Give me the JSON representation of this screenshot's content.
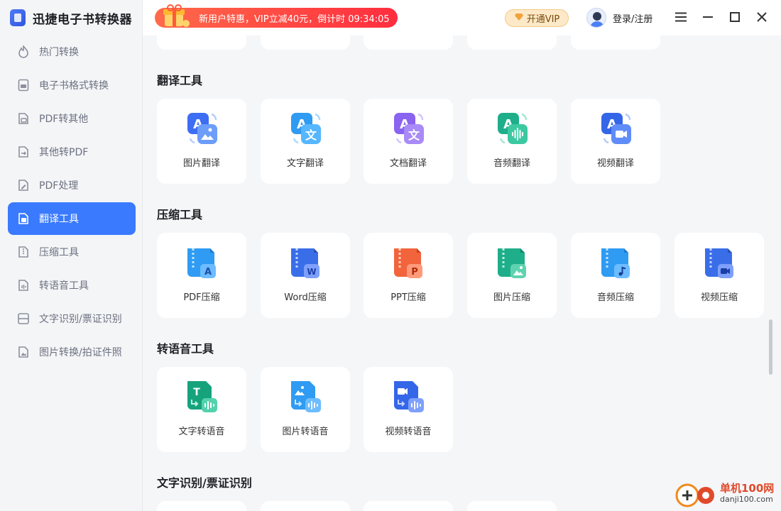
{
  "app": {
    "title": "迅捷电子书转换器"
  },
  "sidebar": {
    "items": [
      {
        "label": "热门转换",
        "icon": "flame-icon"
      },
      {
        "label": "电子书格式转换",
        "icon": "ebook-icon"
      },
      {
        "label": "PDF转其他",
        "icon": "pdf-export-icon"
      },
      {
        "label": "其他转PDF",
        "icon": "pdf-import-icon"
      },
      {
        "label": "PDF处理",
        "icon": "pdf-edit-icon"
      },
      {
        "label": "翻译工具",
        "icon": "translate-icon",
        "active": true
      },
      {
        "label": "压缩工具",
        "icon": "compress-icon"
      },
      {
        "label": "转语音工具",
        "icon": "audio-icon"
      },
      {
        "label": "文字识别/票证识别",
        "icon": "scan-icon"
      },
      {
        "label": "图片转换/拍证件照",
        "icon": "photo-icon"
      }
    ]
  },
  "topbar": {
    "promo": "新用户特惠，VIP立减40元，倒计时 09:34:05",
    "vip_button": "开通VIP",
    "login": "登录/注册"
  },
  "sections": {
    "translate": {
      "title": "翻译工具",
      "items": [
        {
          "label": "图片翻译",
          "icon": "image-translate-icon"
        },
        {
          "label": "文字翻译",
          "icon": "text-translate-icon"
        },
        {
          "label": "文档翻译",
          "icon": "document-translate-icon"
        },
        {
          "label": "音频翻译",
          "icon": "audio-translate-icon"
        },
        {
          "label": "视频翻译",
          "icon": "video-translate-icon"
        }
      ]
    },
    "compress": {
      "title": "压缩工具",
      "items": [
        {
          "label": "PDF压缩",
          "icon": "pdf-compress-icon"
        },
        {
          "label": "Word压缩",
          "icon": "word-compress-icon"
        },
        {
          "label": "PPT压缩",
          "icon": "ppt-compress-icon"
        },
        {
          "label": "图片压缩",
          "icon": "image-compress-icon"
        },
        {
          "label": "音频压缩",
          "icon": "audio-compress-icon"
        },
        {
          "label": "视频压缩",
          "icon": "video-compress-icon"
        }
      ]
    },
    "speech": {
      "title": "转语音工具",
      "items": [
        {
          "label": "文字转语音",
          "icon": "text-to-speech-icon"
        },
        {
          "label": "图片转语音",
          "icon": "image-to-speech-icon"
        },
        {
          "label": "视频转语音",
          "icon": "video-to-speech-icon"
        }
      ]
    },
    "ocr": {
      "title": "文字识别/票证识别"
    }
  },
  "watermark": {
    "name": "单机100网",
    "url": "danji100.com"
  },
  "colors": {
    "accent": "#3a7afe",
    "promo": "#ff3d3d",
    "vip": "#fde9c8"
  }
}
